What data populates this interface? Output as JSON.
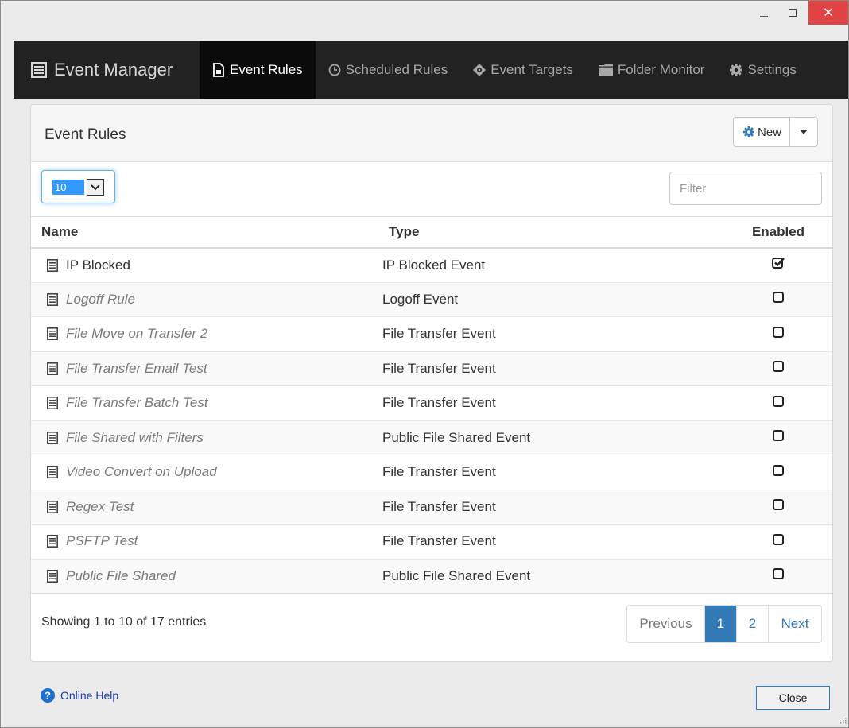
{
  "window": {
    "minimize_label": "_",
    "close_label": "✕"
  },
  "navbar": {
    "brand": "Event Manager",
    "items": [
      {
        "label": "Event Rules",
        "icon": "document-icon",
        "active": true
      },
      {
        "label": "Scheduled Rules",
        "icon": "clock-icon",
        "active": false
      },
      {
        "label": "Event Targets",
        "icon": "crosshair-icon",
        "active": false
      },
      {
        "label": "Folder Monitor",
        "icon": "folder-icon",
        "active": false
      },
      {
        "label": "Settings",
        "icon": "gear-icon",
        "active": false
      }
    ]
  },
  "panel": {
    "title": "Event Rules",
    "new_button": "New",
    "page_length": "10",
    "filter_placeholder": "Filter"
  },
  "table": {
    "headers": {
      "name": "Name",
      "type": "Type",
      "enabled": "Enabled"
    },
    "rows": [
      {
        "name": "IP Blocked",
        "type": "IP Blocked Event",
        "enabled": true
      },
      {
        "name": "Logoff Rule",
        "type": "Logoff Event",
        "enabled": false
      },
      {
        "name": "File Move on Transfer 2",
        "type": "File Transfer Event",
        "enabled": false
      },
      {
        "name": "File Transfer Email Test",
        "type": "File Transfer Event",
        "enabled": false
      },
      {
        "name": "File Transfer Batch Test",
        "type": "File Transfer Event",
        "enabled": false
      },
      {
        "name": "File Shared with Filters",
        "type": "Public File Shared Event",
        "enabled": false
      },
      {
        "name": "Video Convert on Upload",
        "type": "File Transfer Event",
        "enabled": false
      },
      {
        "name": "Regex Test",
        "type": "File Transfer Event",
        "enabled": false
      },
      {
        "name": "PSFTP Test",
        "type": "File Transfer Event",
        "enabled": false
      },
      {
        "name": "Public File Shared",
        "type": "Public File Shared Event",
        "enabled": false
      }
    ]
  },
  "footer": {
    "info": "Showing 1 to 10 of 17 entries",
    "pagination": {
      "previous": "Previous",
      "pages": [
        "1",
        "2"
      ],
      "current": "1",
      "next": "Next"
    }
  },
  "bottom": {
    "help_label": "Online Help",
    "close_label": "Close"
  },
  "colors": {
    "navbar_bg": "#222222",
    "active_tab_bg": "#0b0b0b",
    "accent": "#337ab7",
    "close_window": "#e04343"
  }
}
